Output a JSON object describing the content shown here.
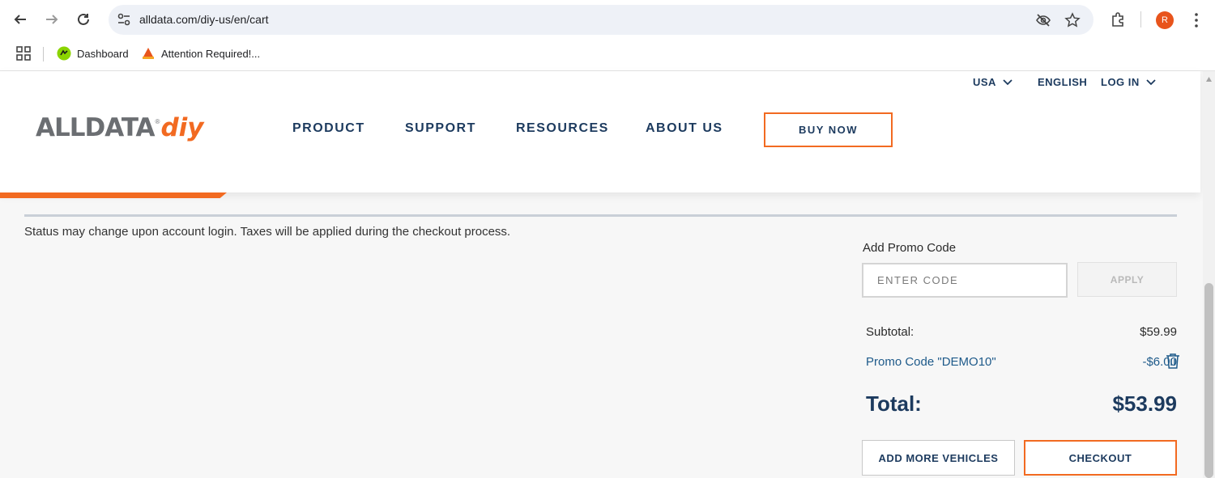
{
  "browser": {
    "url": "alldata.com/diy-us/en/cart",
    "profile_initial": "R",
    "bookmarks": [
      {
        "label": "Dashboard",
        "icon": "dashboard-favicon"
      },
      {
        "label": "Attention Required!...",
        "icon": "attention-favicon"
      }
    ]
  },
  "header": {
    "logo_main": "ALLDATA",
    "logo_reg": "®",
    "logo_diy": "diy",
    "utility": {
      "country": "USA",
      "language": "ENGLISH",
      "login": "LOG IN"
    },
    "nav": [
      "PRODUCT",
      "SUPPORT",
      "RESOURCES",
      "ABOUT US"
    ],
    "buy_now": "BUY NOW"
  },
  "cart": {
    "status_note": "Status may change upon account login. Taxes will be applied during the checkout process.",
    "promo": {
      "label": "Add Promo Code",
      "placeholder": "ENTER CODE",
      "apply": "APPLY"
    },
    "subtotal_label": "Subtotal:",
    "subtotal_value": "$59.99",
    "promo_applied_label": "Promo Code \"DEMO10\"",
    "promo_applied_value": "-$6.00",
    "total_label": "Total:",
    "total_value": "$53.99",
    "add_more": "ADD MORE VEHICLES",
    "checkout": "CHECKOUT"
  },
  "colors": {
    "brand_orange": "#f26a21",
    "brand_navy": "#1c3a5e",
    "logo_gray": "#6b6e72",
    "promo_blue": "#1e5a8a"
  }
}
